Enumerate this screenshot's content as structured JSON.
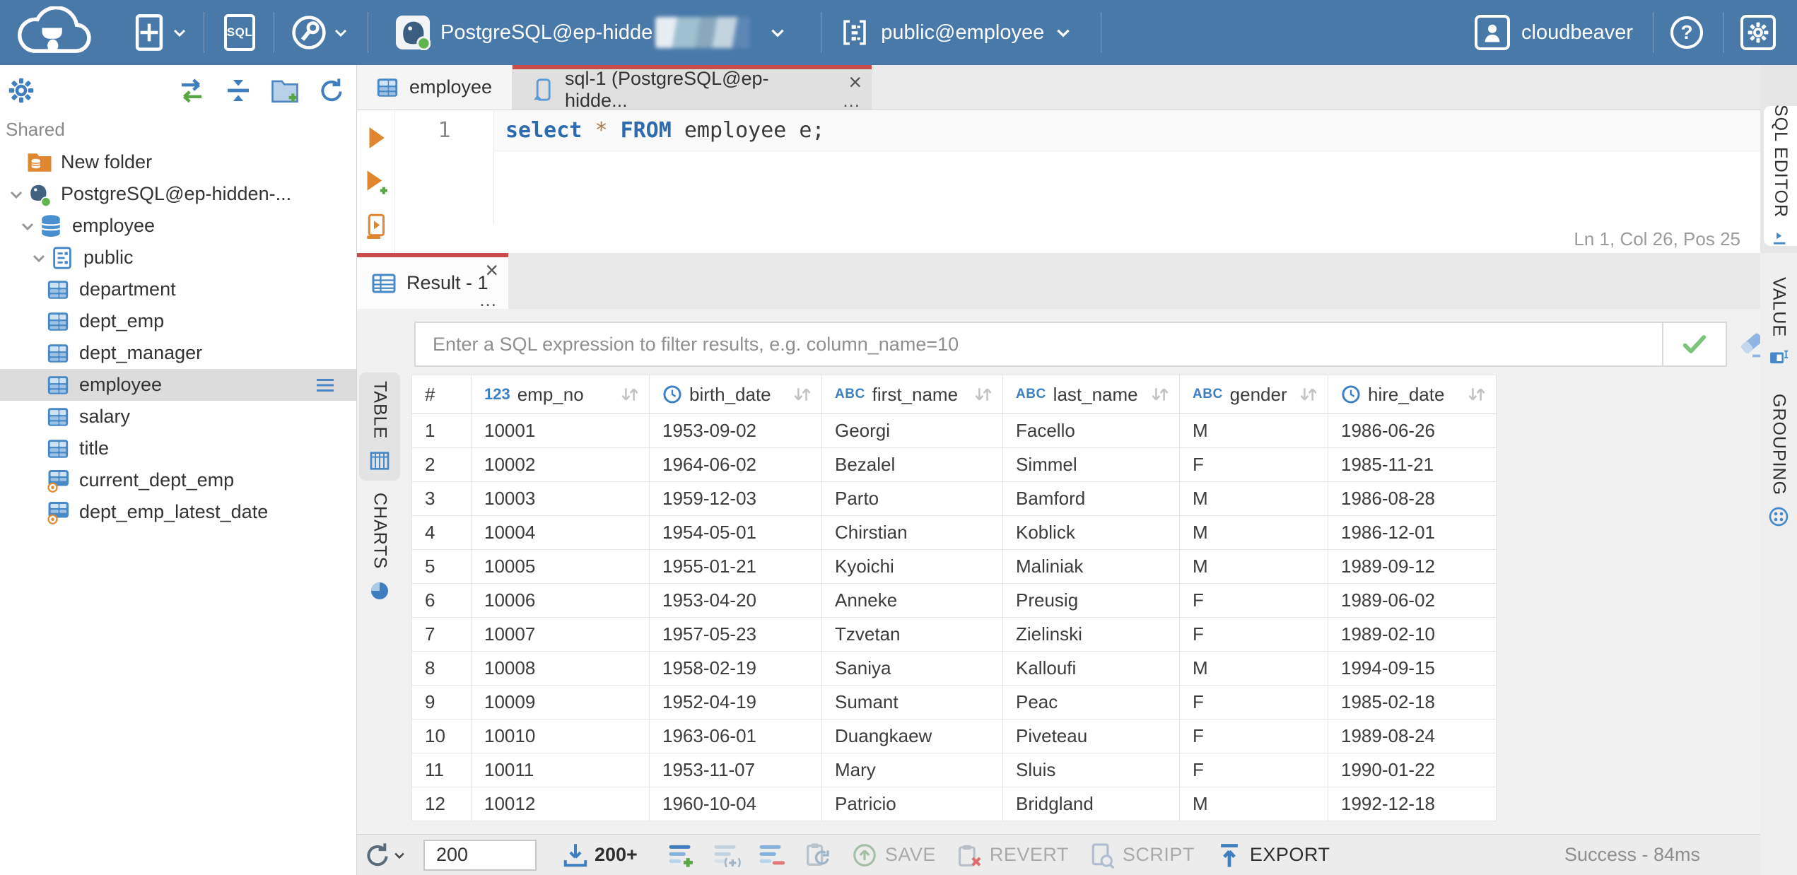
{
  "topbar": {
    "app_name": "cloudbeaver",
    "sql_badge": "SQL",
    "help_glyph": "?",
    "connection_label": "PostgreSQL@ep-hidde",
    "schema_label": "public@employee",
    "accent_color": "#4979a9"
  },
  "sidebar": {
    "section_label": "Shared",
    "tree": [
      {
        "label": "New folder",
        "icon": "folder-database"
      },
      {
        "label": "PostgreSQL@ep-hidden-...",
        "icon": "postgres-connection",
        "expanded": true
      },
      {
        "label": "employee",
        "icon": "database",
        "expanded": true
      },
      {
        "label": "public",
        "icon": "schema",
        "expanded": true
      },
      {
        "label": "department",
        "icon": "table"
      },
      {
        "label": "dept_emp",
        "icon": "table"
      },
      {
        "label": "dept_manager",
        "icon": "table"
      },
      {
        "label": "employee",
        "icon": "table",
        "selected": true
      },
      {
        "label": "salary",
        "icon": "table"
      },
      {
        "label": "title",
        "icon": "table"
      },
      {
        "label": "current_dept_emp",
        "icon": "view"
      },
      {
        "label": "dept_emp_latest_date",
        "icon": "view"
      }
    ]
  },
  "editor": {
    "tabs": [
      {
        "label": "employee"
      },
      {
        "label": "sql-1 (PostgreSQL@ep-hidde..."
      }
    ],
    "line_number": "1",
    "sql_tokens": [
      {
        "text": "select"
      },
      {
        "text": " "
      },
      {
        "text": "*"
      },
      {
        "text": " "
      },
      {
        "text": "FROM"
      },
      {
        "text": " employee e;"
      }
    ],
    "status_line": "Ln 1, Col 26, Pos 25"
  },
  "result": {
    "tab_label": "Result - 1",
    "filter_placeholder": "Enter a SQL expression to filter results, e.g. column_name=10",
    "left_tabs": [
      {
        "label": "TABLE"
      },
      {
        "label": "CHARTS"
      }
    ],
    "side_panels": {
      "sql_editor": "SQL EDITOR",
      "value": "VALUE",
      "grouping": "GROUPING"
    }
  },
  "icons": {
    "close": "×",
    "more": "..."
  },
  "grid": {
    "type_icons": {
      "number": "123",
      "string": "ABC"
    },
    "columns": [
      {
        "name": "#",
        "type": "index"
      },
      {
        "name": "emp_no",
        "type": "number"
      },
      {
        "name": "birth_date",
        "type": "date"
      },
      {
        "name": "first_name",
        "type": "string"
      },
      {
        "name": "last_name",
        "type": "string"
      },
      {
        "name": "gender",
        "type": "string"
      },
      {
        "name": "hire_date",
        "type": "date"
      }
    ],
    "rows": [
      [
        "1",
        "10001",
        "1953-09-02",
        "Georgi",
        "Facello",
        "M",
        "1986-06-26"
      ],
      [
        "2",
        "10002",
        "1964-06-02",
        "Bezalel",
        "Simmel",
        "F",
        "1985-11-21"
      ],
      [
        "3",
        "10003",
        "1959-12-03",
        "Parto",
        "Bamford",
        "M",
        "1986-08-28"
      ],
      [
        "4",
        "10004",
        "1954-05-01",
        "Chirstian",
        "Koblick",
        "M",
        "1986-12-01"
      ],
      [
        "5",
        "10005",
        "1955-01-21",
        "Kyoichi",
        "Maliniak",
        "M",
        "1989-09-12"
      ],
      [
        "6",
        "10006",
        "1953-04-20",
        "Anneke",
        "Preusig",
        "F",
        "1989-06-02"
      ],
      [
        "7",
        "10007",
        "1957-05-23",
        "Tzvetan",
        "Zielinski",
        "F",
        "1989-02-10"
      ],
      [
        "8",
        "10008",
        "1958-02-19",
        "Saniya",
        "Kalloufi",
        "M",
        "1994-09-15"
      ],
      [
        "9",
        "10009",
        "1952-04-19",
        "Sumant",
        "Peac",
        "F",
        "1985-02-18"
      ],
      [
        "10",
        "10010",
        "1963-06-01",
        "Duangkaew",
        "Piveteau",
        "F",
        "1989-08-24"
      ],
      [
        "11",
        "10011",
        "1953-11-07",
        "Mary",
        "Sluis",
        "F",
        "1990-01-22"
      ],
      [
        "12",
        "10012",
        "1960-10-04",
        "Patricio",
        "Bridgland",
        "M",
        "1992-12-18"
      ]
    ]
  },
  "toolbar": {
    "row_limit": "200",
    "fetch_label": "200+",
    "save_label": "SAVE",
    "revert_label": "REVERT",
    "script_label": "SCRIPT",
    "export_label": "EXPORT",
    "status": "Success - 84ms"
  }
}
